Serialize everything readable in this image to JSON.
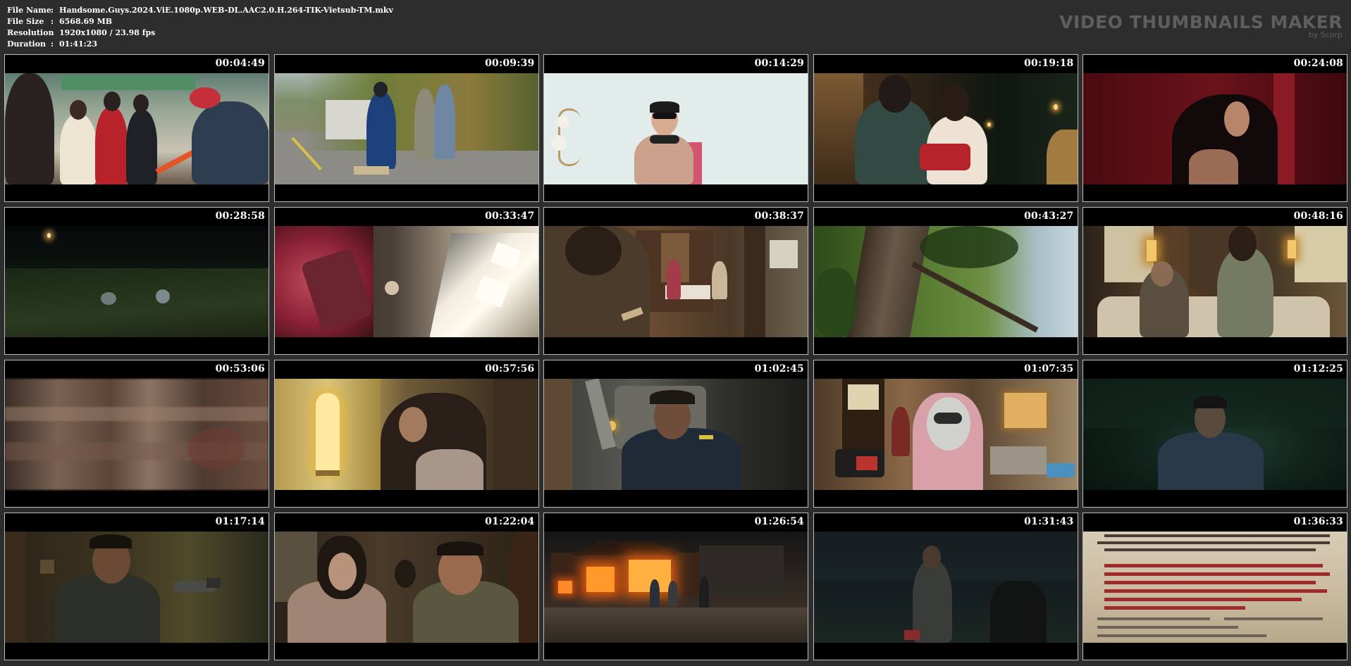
{
  "file_info": {
    "rows": [
      {
        "label": "File Name",
        "value": "Handsome.Guys.2024.ViE.1080p.WEB-DL.AAC2.0.H.264-TIK-Vietsub-TM.mkv"
      },
      {
        "label": "File Size",
        "value": "6568.69 MB"
      },
      {
        "label": "Resolution",
        "value": "1920x1080 / 23.98 fps"
      },
      {
        "label": "Duration",
        "value": "01:41:23"
      }
    ],
    "separator": ":"
  },
  "brand": {
    "title": "VIDEO THUMBNAILS MAKER",
    "subtitle": "by Scorp"
  },
  "thumbnails": [
    {
      "time": "00:04:49"
    },
    {
      "time": "00:09:39"
    },
    {
      "time": "00:14:29"
    },
    {
      "time": "00:19:18"
    },
    {
      "time": "00:24:08"
    },
    {
      "time": "00:28:58"
    },
    {
      "time": "00:33:47"
    },
    {
      "time": "00:38:37"
    },
    {
      "time": "00:43:27"
    },
    {
      "time": "00:48:16"
    },
    {
      "time": "00:53:06"
    },
    {
      "time": "00:57:56"
    },
    {
      "time": "01:02:45"
    },
    {
      "time": "01:07:35"
    },
    {
      "time": "01:12:25"
    },
    {
      "time": "01:17:14"
    },
    {
      "time": "01:22:04"
    },
    {
      "time": "01:26:54"
    },
    {
      "time": "01:31:43"
    },
    {
      "time": "01:36:33"
    }
  ],
  "colors": {
    "background": "#2d2d2d",
    "thumb_border": "#bdbdbd",
    "brand_text": "#5e5e5e",
    "info_text": "#ffffff"
  }
}
